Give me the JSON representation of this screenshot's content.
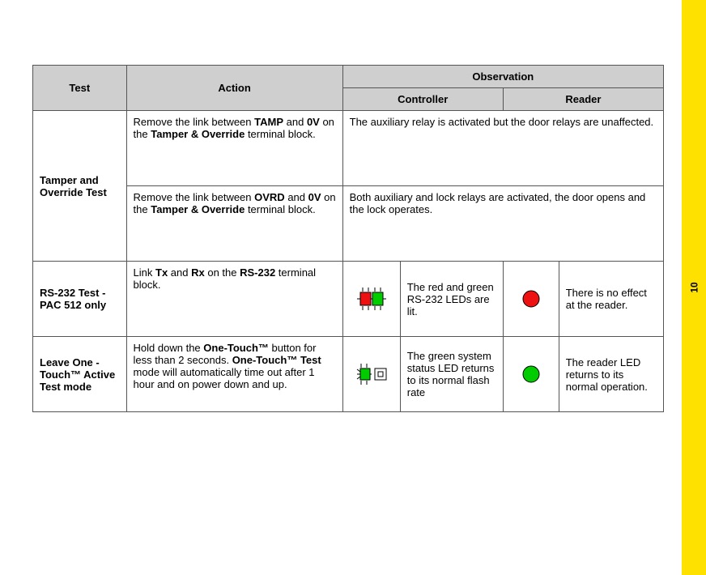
{
  "page_number": "10",
  "headers": {
    "test": "Test",
    "action": "Action",
    "observation": "Observation",
    "controller": "Controller",
    "reader": "Reader"
  },
  "row1": {
    "test": "Tamper and Override Test",
    "action_a_1": "Remove the link between ",
    "action_a_b1": "TAMP",
    "action_a_2": " and ",
    "action_a_b2": "0V",
    "action_a_3": " on the ",
    "action_a_b3": "Tamper & Override",
    "action_a_4": " terminal block.",
    "obs_a": "The auxiliary relay is activated but the door relays are unaffected.",
    "action_b_1": "Remove the link between ",
    "action_b_b1": "OVRD",
    "action_b_2": " and ",
    "action_b_b2": "0V",
    "action_b_3": " on the ",
    "action_b_b3": "Tamper & Override",
    "action_b_4": " terminal block.",
    "obs_b": "Both auxiliary and lock relays are activated, the door opens and the lock operates."
  },
  "row2": {
    "test": "RS-232 Test - PAC 512 only",
    "action_1": "Link ",
    "action_b1": "Tx",
    "action_2": " and ",
    "action_b2": "Rx",
    "action_3": " on the ",
    "action_b3": "RS-232",
    "action_4": " terminal block.",
    "controller_text": "The red and green RS-232 LEDs are lit.",
    "reader_text": "There is no effect at the reader."
  },
  "row3": {
    "test": "Leave One -Touch™ Active Test mode",
    "action_1": "Hold down the ",
    "action_b1": "One-Touch™",
    "action_2": " button for less than 2 seconds. ",
    "action_b2": "One-Touch™ Test",
    "action_3": " mode will automatically time out after 1 hour and on power down and up.",
    "controller_text": "The green system status LED returns to its normal flash rate",
    "reader_text": "The reader LED returns to its normal operation."
  }
}
